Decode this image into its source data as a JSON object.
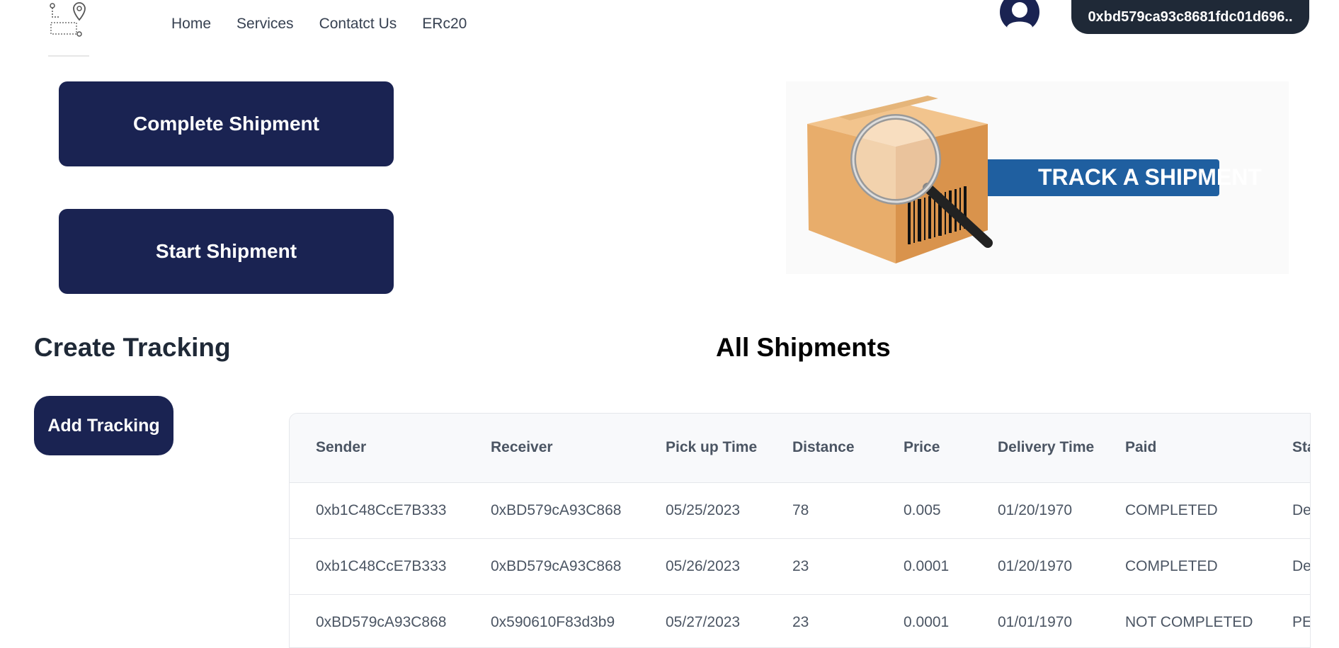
{
  "nav": {
    "items": [
      "Home",
      "Services",
      "Contatct Us",
      "ERc20"
    ],
    "wallet": "0xbd579ca93c8681fdc01d696.."
  },
  "actions": {
    "complete_label": "Complete Shipment",
    "start_label": "Start Shipment"
  },
  "hero": {
    "banner_text": "TRACK A SHIPMENT"
  },
  "create_tracking": {
    "title": "Create Tracking",
    "add_label": "Add Tracking"
  },
  "shipments": {
    "title": "All Shipments",
    "columns": [
      "Sender",
      "Receiver",
      "Pick up Time",
      "Distance",
      "Price",
      "Delivery Time",
      "Paid",
      "Sta"
    ],
    "rows": [
      [
        "0xb1C48CcE7B333",
        "0xBD579cA93C868",
        "05/25/2023",
        "78",
        "0.005",
        "01/20/1970",
        "COMPLETED",
        "De"
      ],
      [
        "0xb1C48CcE7B333",
        "0xBD579cA93C868",
        "05/26/2023",
        "23",
        "0.0001",
        "01/20/1970",
        "COMPLETED",
        "De"
      ],
      [
        "0xBD579cA93C868",
        "0x590610F83d3b9",
        "05/27/2023",
        "23",
        "0.0001",
        "01/01/1970",
        "NOT COMPLETED",
        "PE"
      ]
    ]
  },
  "colors": {
    "primary": "#1a2352",
    "wallet_bg": "#1f2937",
    "banner": "#1f5fa0"
  },
  "icons": [
    "route-logo-icon",
    "user-avatar-icon",
    "magnifier-box-icon"
  ]
}
